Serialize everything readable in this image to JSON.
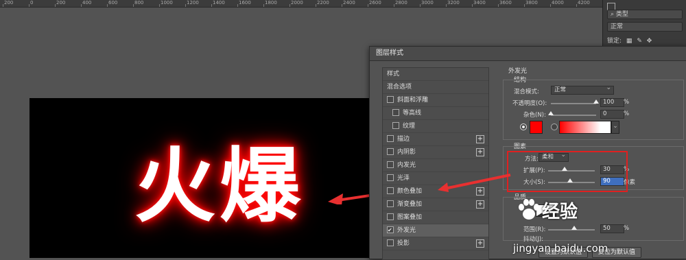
{
  "ruler": {
    "labels": [
      "200",
      "0",
      "200",
      "400",
      "600",
      "800",
      "1000",
      "1200",
      "1400",
      "1600",
      "1800",
      "2000",
      "2200",
      "2400",
      "2600",
      "2800",
      "3000",
      "3200",
      "3400",
      "3600",
      "3800",
      "4000",
      "4200"
    ]
  },
  "canvas": {
    "text": "火爆",
    "glow_color": "#ff0000"
  },
  "right_panel": {
    "kind_label": "类型",
    "mode": "正常",
    "lock_label": "锁定:"
  },
  "dialog": {
    "title": "图层样式",
    "styles_header": "样式",
    "blend_options": "混合选项",
    "items": [
      {
        "label": "斜面和浮雕",
        "checked": false,
        "plus": false,
        "indent": false
      },
      {
        "label": "等高线",
        "checked": false,
        "plus": false,
        "indent": true
      },
      {
        "label": "纹理",
        "checked": false,
        "plus": false,
        "indent": true
      },
      {
        "label": "描边",
        "checked": false,
        "plus": true,
        "indent": false
      },
      {
        "label": "内阴影",
        "checked": false,
        "plus": true,
        "indent": false
      },
      {
        "label": "内发光",
        "checked": false,
        "plus": false,
        "indent": false
      },
      {
        "label": "光泽",
        "checked": false,
        "plus": false,
        "indent": false
      },
      {
        "label": "颜色叠加",
        "checked": false,
        "plus": true,
        "indent": false
      },
      {
        "label": "渐变叠加",
        "checked": false,
        "plus": true,
        "indent": false
      },
      {
        "label": "图案叠加",
        "checked": false,
        "plus": false,
        "indent": false
      },
      {
        "label": "外发光",
        "checked": true,
        "plus": false,
        "indent": false,
        "active": true
      },
      {
        "label": "投影",
        "checked": false,
        "plus": true,
        "indent": false
      }
    ],
    "outer_glow": {
      "title": "外发光",
      "structure": "结构",
      "blend_mode_label": "混合模式:",
      "blend_mode_value": "正常",
      "opacity_label": "不透明度(O):",
      "opacity_value": "100",
      "noise_label": "杂色(N):",
      "noise_value": "0",
      "percent": "%",
      "glow_color": "#ff0000",
      "elements": "图素",
      "technique_label": "方法:",
      "technique_value": "柔和",
      "spread_label": "扩展(P):",
      "spread_value": "30",
      "size_label": "大小(S):",
      "size_value": "90",
      "size_unit": "像素",
      "quality": "品质",
      "range_label": "范围(R):",
      "range_value": "50",
      "jitter_label": "抖动(J):"
    },
    "btn_set_default": "设置为默认值",
    "btn_reset_default": "复位为默认值"
  },
  "watermark": {
    "text": "经验",
    "url": "jingyan.baidu.com"
  }
}
